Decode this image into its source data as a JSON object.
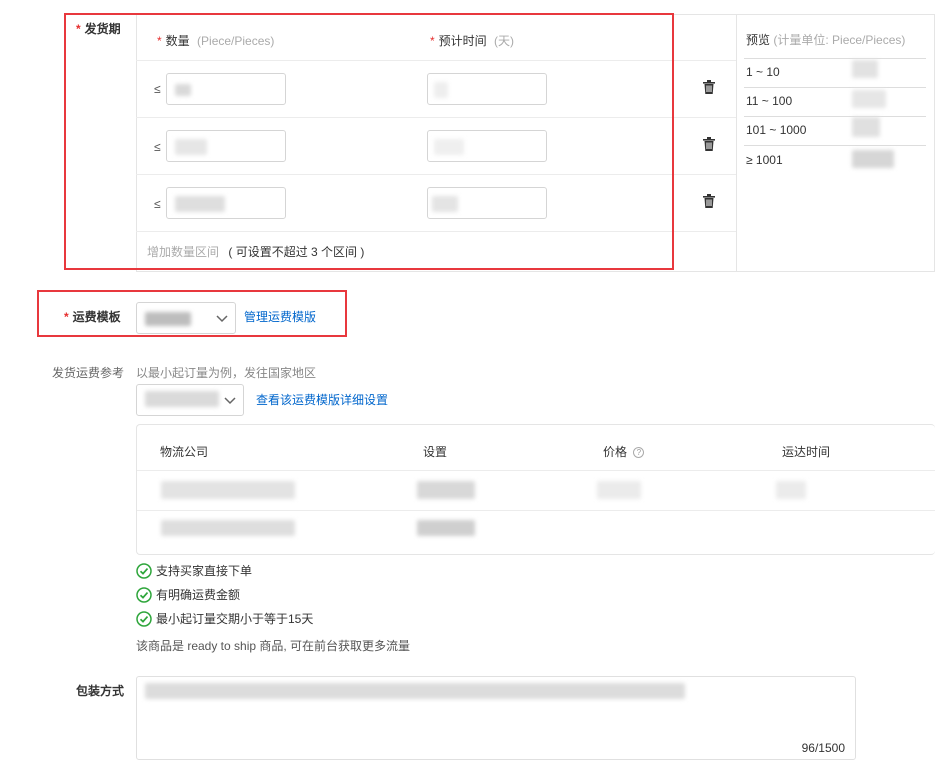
{
  "delivery": {
    "label": "发货期",
    "quantity_header": "数量",
    "quantity_unit": "(Piece/Pieces)",
    "time_header": "预计时间",
    "time_unit": "(天)",
    "le_symbol": "≤",
    "add_range": "增加数量区间",
    "add_range_hint": "( 可设置不超过 3 个区间 )",
    "rows": [
      {
        "qty_value": "",
        "time_value": ""
      },
      {
        "qty_value": "",
        "time_value": ""
      },
      {
        "qty_value": "",
        "time_value": ""
      }
    ]
  },
  "preview": {
    "title": "预览",
    "unit": "(计量单位: Piece/Pieces)",
    "ranges": [
      "1 ~ 10",
      "11 ~ 100",
      "101 ~ 1000",
      "≥ 1001"
    ]
  },
  "shipping_template": {
    "label": "运费模板",
    "manage_link": "管理运费模版"
  },
  "shipping_reference": {
    "label": "发货运费参考",
    "hint": "以最小起订量为例，发往国家地区",
    "detail_link": "查看该运费模版详细设置",
    "columns": [
      "物流公司",
      "设置",
      "价格",
      "运达时间"
    ]
  },
  "checks": [
    "支持买家直接下单",
    "有明确运费金额",
    "最小起订量交期小于等于15天"
  ],
  "ready_to_ship_note": "该商品是 ready to ship 商品, 可在前台获取更多流量",
  "packaging": {
    "label": "包装方式",
    "char_count": "96/1500"
  },
  "colors": {
    "highlight_red": "#e8383d",
    "link_blue": "#0066cc",
    "check_green": "#2da53a"
  }
}
